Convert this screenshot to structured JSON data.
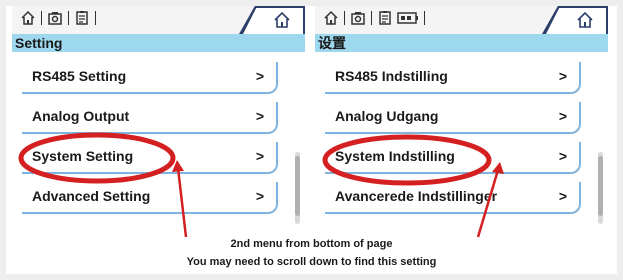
{
  "colors": {
    "accent_tab": "#2c3e6a",
    "title_bar": "#9ed8ee",
    "item_border": "#7fb3e0",
    "annotation_red": "#d42020"
  },
  "panels": [
    {
      "title": "Setting",
      "top_icons": [
        "home-icon",
        "camera-icon",
        "document-icon"
      ],
      "items": [
        {
          "label": "RS485 Setting",
          "chevron": ">"
        },
        {
          "label": "Analog Output",
          "chevron": ">"
        },
        {
          "label": "System Setting",
          "chevron": ">"
        },
        {
          "label": "Advanced Setting",
          "chevron": ">"
        }
      ]
    },
    {
      "title": "设置",
      "top_icons": [
        "home-icon",
        "camera-icon",
        "document-icon",
        "battery-icon"
      ],
      "items": [
        {
          "label": "RS485 Indstilling",
          "chevron": ">"
        },
        {
          "label": "Analog Udgang",
          "chevron": ">"
        },
        {
          "label": "System Indstilling",
          "chevron": ">"
        },
        {
          "label": "Avancerede Indstillinger",
          "chevron": ">"
        }
      ]
    }
  ],
  "annotation": {
    "line1": "2nd menu from bottom of page",
    "line2": "You may need to scroll down to find this setting"
  }
}
